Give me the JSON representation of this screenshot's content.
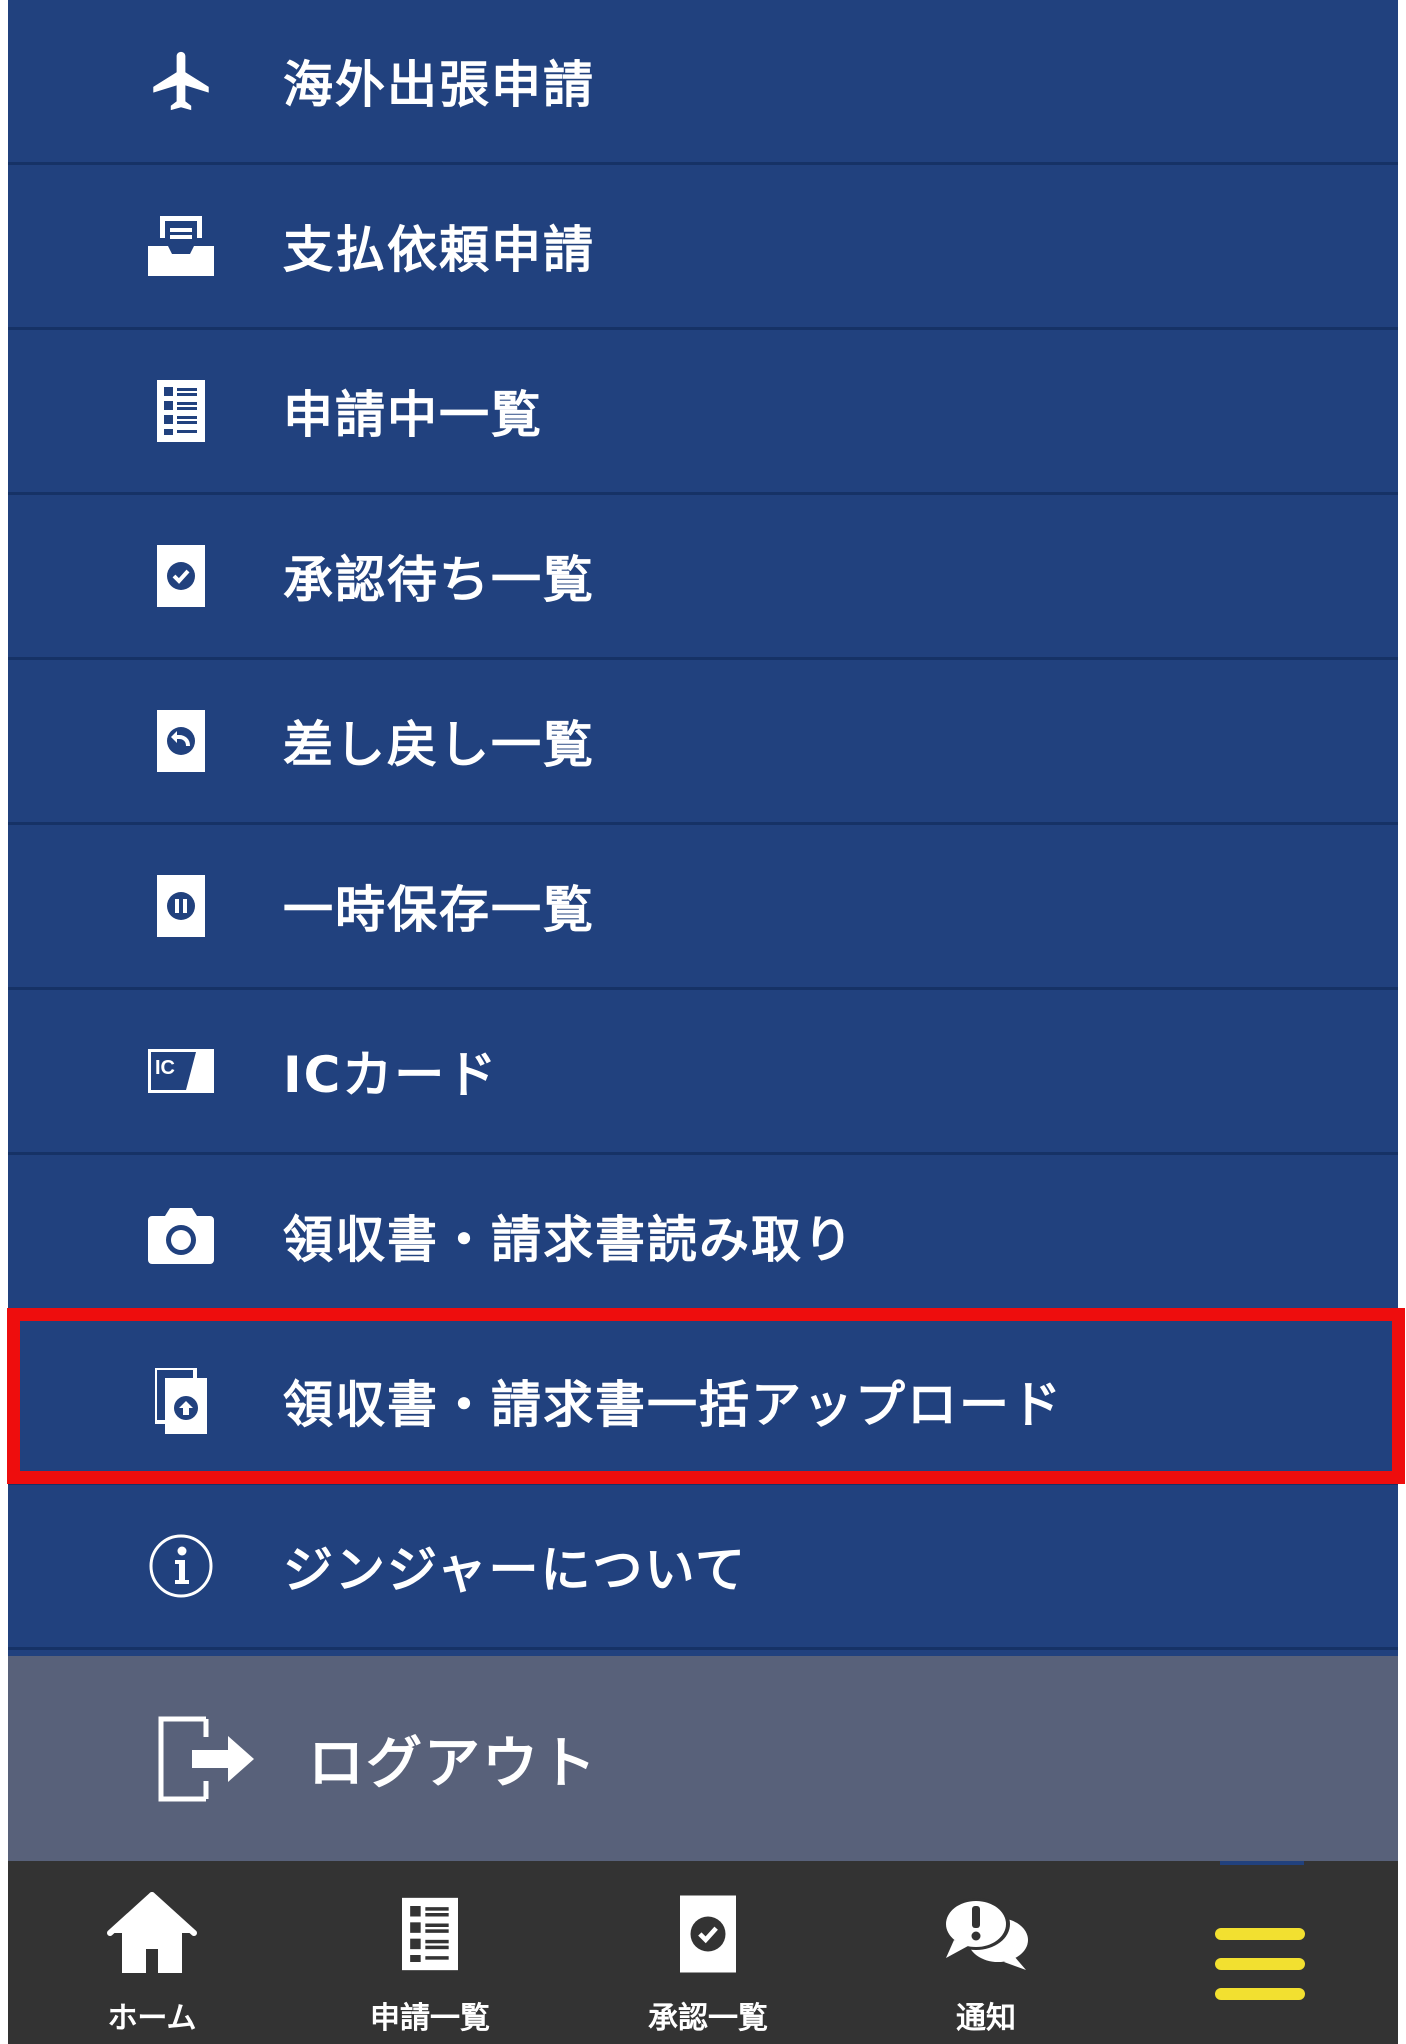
{
  "menu": {
    "items": [
      {
        "label": "海外出張申請",
        "icon": "airplane-icon"
      },
      {
        "label": "支払依頼申請",
        "icon": "inbox-tray-icon"
      },
      {
        "label": "申請中一覧",
        "icon": "document-list-icon"
      },
      {
        "label": "承認待ち一覧",
        "icon": "document-check-icon"
      },
      {
        "label": "差し戻し一覧",
        "icon": "document-return-icon"
      },
      {
        "label": "一時保存一覧",
        "icon": "document-pause-icon"
      },
      {
        "label": "ICカード",
        "icon": "ic-card-icon",
        "icon_text": "IC"
      },
      {
        "label": "領収書・請求書読み取り",
        "icon": "camera-icon"
      },
      {
        "label": "領収書・請求書一括アップロード",
        "icon": "document-upload-icon",
        "highlighted": true
      },
      {
        "label": "ジンジャーについて",
        "icon": "info-icon"
      }
    ],
    "logout": {
      "label": "ログアウト",
      "icon": "logout-icon"
    }
  },
  "tabbar": {
    "tabs": [
      {
        "label": "ホーム",
        "icon": "home-icon"
      },
      {
        "label": "申請一覧",
        "icon": "document-list-icon"
      },
      {
        "label": "承認一覧",
        "icon": "document-check-icon"
      },
      {
        "label": "通知",
        "icon": "chat-alert-icon"
      },
      {
        "label": "",
        "icon": "hamburger-menu-icon",
        "active": true
      }
    ]
  },
  "colors": {
    "menu_bg": "#21417e",
    "logout_bg": "#58617a",
    "tabbar_bg": "#333333",
    "highlight_border": "#ee0d0d",
    "active_accent": "#f2e030"
  }
}
